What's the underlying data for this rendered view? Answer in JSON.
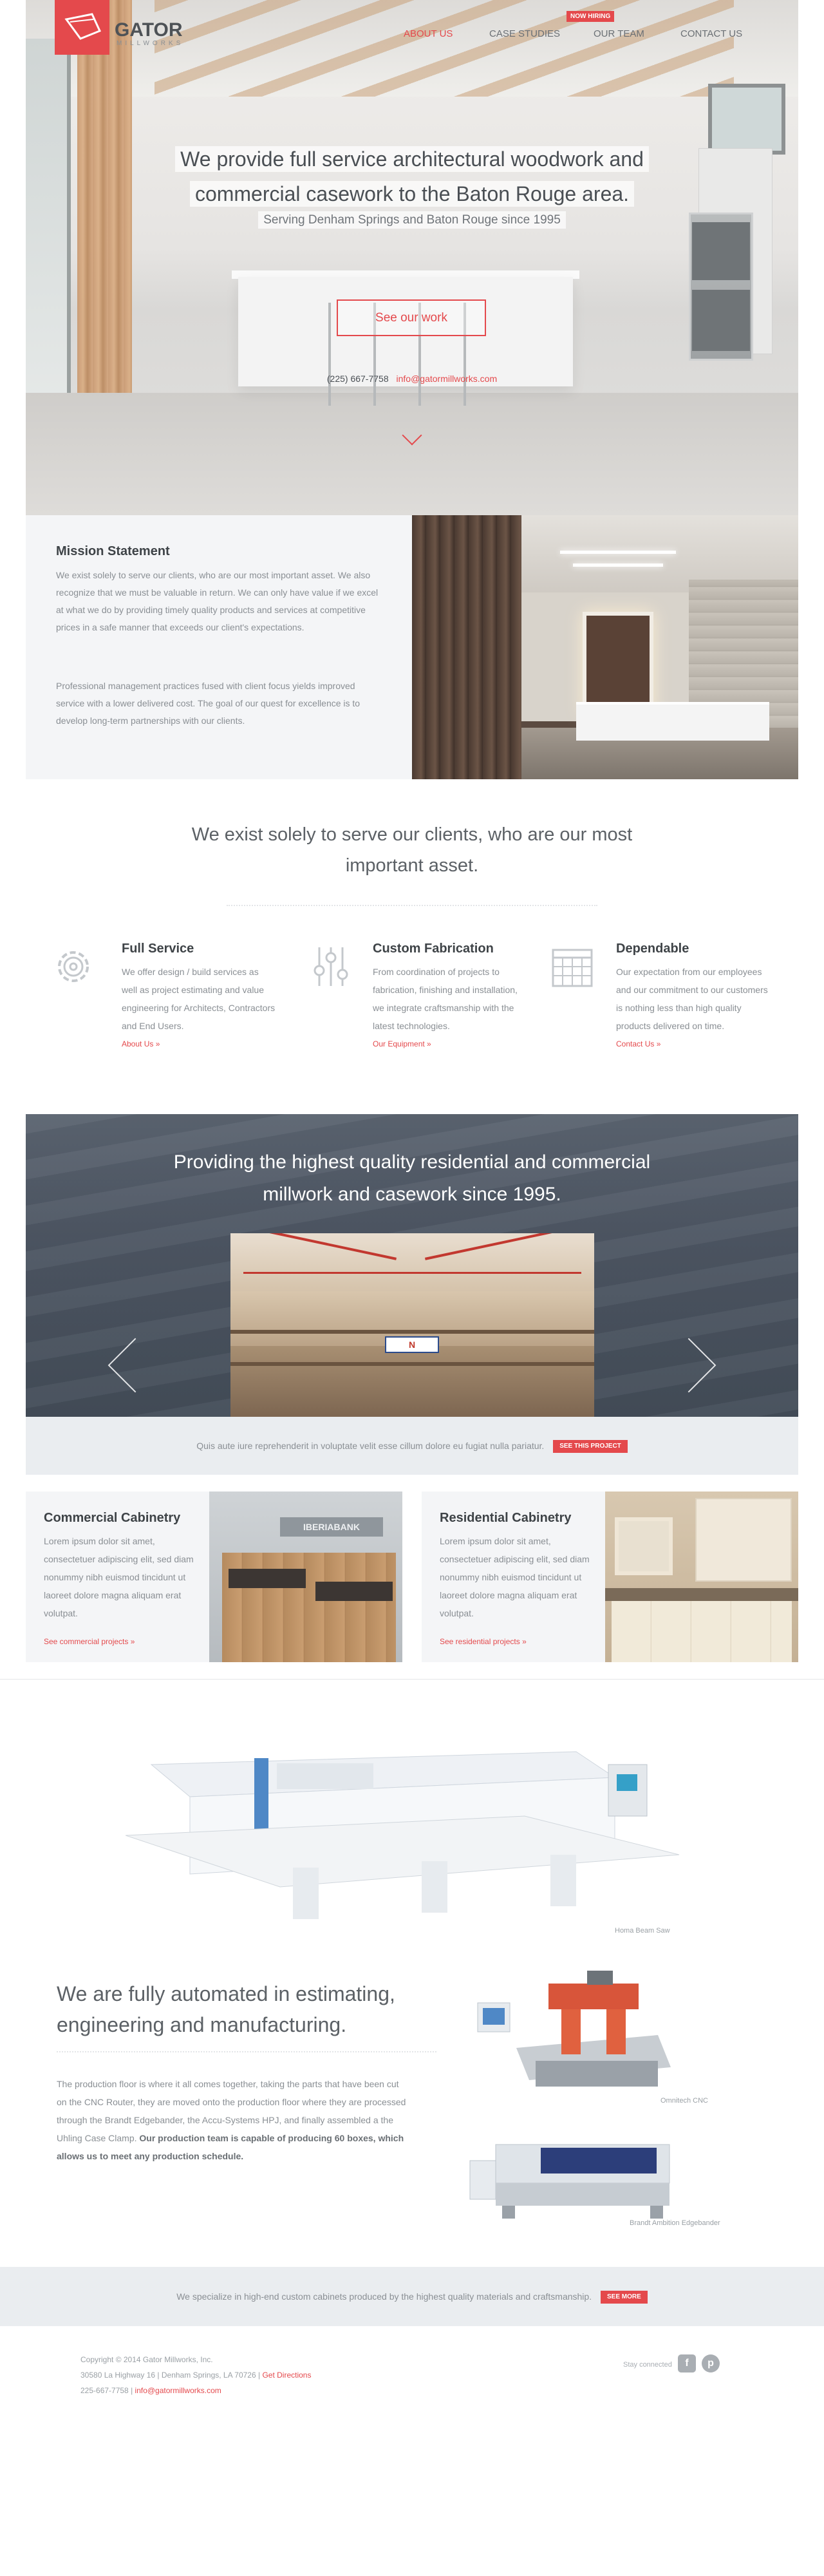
{
  "brand": {
    "name": "GATOR",
    "tagline": "MILLWORKS",
    "accent": "#e4494c"
  },
  "nav": {
    "items": [
      {
        "label": "ABOUT US",
        "active": true
      },
      {
        "label": "CASE STUDIES",
        "active": false
      },
      {
        "label": "OUR TEAM",
        "active": false
      },
      {
        "label": "CONTACT US",
        "active": false
      }
    ],
    "hiring_badge": "NOW HIRING"
  },
  "hero": {
    "title_line1": "We provide full service architectural woodwork and",
    "title_line2": "commercial casework to the Baton Rouge area.",
    "subtitle": "Serving Denham Springs and Baton Rouge since 1995",
    "button": "See our work",
    "phone": "(225) 667-7758",
    "email": "info@gatormillworks.com"
  },
  "mission": {
    "heading": "Mission Statement",
    "para1": "We exist solely to serve our clients, who are our most important asset. We also recognize that we must be valuable in return. We can only have value if we excel at what we do by providing timely quality products and services at competitive prices in a safe manner that exceeds our client's expectations.",
    "para2": "Professional management practices fused with client focus yields improved service with a lower delivered cost. The goal of our quest for excellence is to develop long-term partnerships with our clients."
  },
  "values": {
    "headline_line1": "We exist solely to serve our clients, who are our most",
    "headline_line2": "important asset.",
    "features": [
      {
        "icon": "gear-icon",
        "title": "Full Service",
        "text": "We offer design / build services as well as project estimating and value engineering for Architects, Contractors and End Users.",
        "link": "About Us »"
      },
      {
        "icon": "sliders-icon",
        "title": "Custom Fabrication",
        "text": "From coordination of projects to fabrication, finishing and installation, we integrate craftsmanship with the latest technologies.",
        "link": "Our Equipment »"
      },
      {
        "icon": "calendar-icon",
        "title": "Dependable",
        "text": "Our expectation from our employees and our commitment to our customers is nothing less than high quality products delivered on time.",
        "link": "Contact Us »"
      }
    ]
  },
  "banner": {
    "title_line1": "Providing the highest quality residential and commercial",
    "title_line2": "millwork and casework since 1995.",
    "slide_sign": "N",
    "cta_text": "Quis aute iure reprehenderit in voluptate velit esse cillum dolore eu fugiat nulla pariatur.",
    "cta_button": "SEE THIS PROJECT"
  },
  "cabinetry": [
    {
      "title": "Commercial Cabinetry",
      "text": "Lorem ipsum dolor sit amet, consectetuer adipiscing elit, sed diam nonummy nibh euismod tincidunt ut laoreet dolore magna aliquam erat volutpat.",
      "link": "See commercial projects »",
      "sign": "IBERIABANK"
    },
    {
      "title": "Residential Cabinetry",
      "text": "Lorem ipsum dolor sit amet, consectetuer adipiscing elit, sed diam nonummy nibh euismod tincidunt ut laoreet dolore magna aliquam erat volutpat.",
      "link": "See residential projects »"
    }
  ],
  "automation": {
    "saw_caption": "Homa Beam Saw",
    "title": "We are fully automated in estimating, engineering and manufacturing.",
    "text": "The production floor is where it all comes together, taking the parts that have been cut on the CNC Router, they are moved onto the production floor where they are processed through the Brandt Edgebander, the Accu-Systems HPJ, and finally assembled a the Uhling Case Clamp.",
    "text_bold": "Our production team is capable of producing 60 boxes, which allows us to meet any production schedule.",
    "cnc_caption": "Omnitech CNC",
    "edge_caption": "Brandt Ambition Edgebander"
  },
  "specialize": {
    "text": "We specialize in high-end custom cabinets produced by the highest quality materials and craftsmanship.",
    "button": "SEE MORE"
  },
  "footer": {
    "copyright": "Copyright © 2014 Gator Millworks, Inc.",
    "address": "30580 La Highway 16 | Denham Springs, LA 70726 |",
    "directions": "Get Directions",
    "phone": "225-667-7758 |",
    "email": "info@gatormillworks.com",
    "stay_connected": "Stay connected",
    "social": [
      {
        "icon": "facebook-icon",
        "glyph": "f"
      },
      {
        "icon": "pinterest-icon",
        "glyph": "p"
      }
    ]
  }
}
